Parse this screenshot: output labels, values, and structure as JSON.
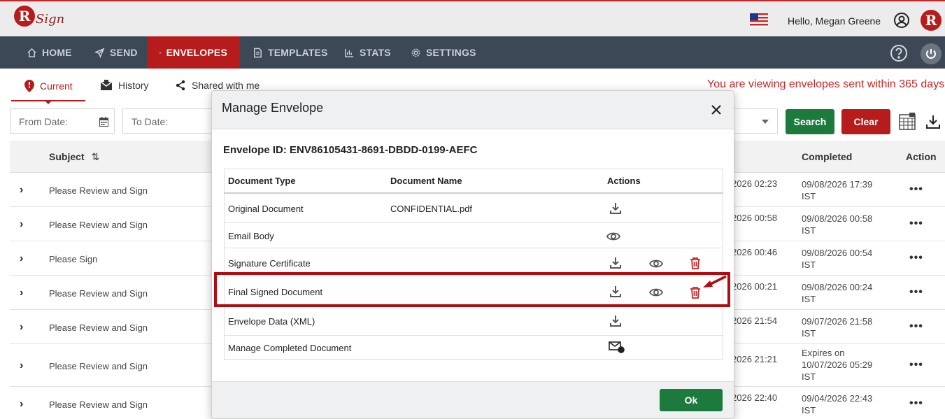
{
  "header": {
    "brand_text": "Sign",
    "greeting": "Hello, Megan Greene",
    "brand_initial": "R"
  },
  "nav": {
    "items": [
      {
        "label": "HOME",
        "icon": "home-icon"
      },
      {
        "label": "SEND",
        "icon": "send-icon"
      },
      {
        "label": "ENVELOPES",
        "icon": "envelope-icon",
        "active": true
      },
      {
        "label": "TEMPLATES",
        "icon": "document-icon"
      },
      {
        "label": "STATS",
        "icon": "chart-icon"
      },
      {
        "label": "SETTINGS",
        "icon": "gear-icon"
      }
    ]
  },
  "subtabs": {
    "current": "Current",
    "history": "History",
    "shared": "Shared with me"
  },
  "notice": "You are viewing envelopes sent within 365 days.",
  "filters": {
    "from_date": "From Date:",
    "to_date": "To Date:",
    "search": "Search",
    "clear": "Clear"
  },
  "table": {
    "headers": {
      "subject": "Subject",
      "completed": "Completed",
      "action": "Action"
    },
    "rows": [
      {
        "subject": "Please Review and Sign",
        "sent": "2026 02:23",
        "completed": "09/08/2026 17:39 IST"
      },
      {
        "subject": "Please Review and Sign",
        "sent": "2026 00:58",
        "completed": "09/08/2026 00:58 IST"
      },
      {
        "subject": "Please Sign",
        "sent": "2026 00:46",
        "completed": "09/08/2026 00:54 IST"
      },
      {
        "subject": "Please Review and Sign",
        "sent": "2026 00:21",
        "completed": "09/08/2026 00:24 IST"
      },
      {
        "subject": "Please Review and Sign",
        "sent": "2026 21:54",
        "completed": "09/07/2026 21:58 IST"
      },
      {
        "subject": "Please Review and Sign",
        "sent": "2026 21:21",
        "completed": "Expires on 10/07/2026 05:29 IST"
      },
      {
        "subject": "Please Review and Sign",
        "sent": "2026 22:40",
        "completed": "09/04/2026 22:43 IST"
      }
    ]
  },
  "modal": {
    "title": "Manage Envelope",
    "envelope_id": "Envelope ID: ENV86105431-8691-DBDD-0199-AEFC",
    "headers": {
      "type": "Document Type",
      "name": "Document Name",
      "actions": "Actions"
    },
    "rows": [
      {
        "type": "Original Document",
        "name": "CONFIDENTIAL.pdf"
      },
      {
        "type": "Email Body",
        "name": ""
      },
      {
        "type": "Signature Certificate",
        "name": ""
      },
      {
        "type": "Final Signed Document",
        "name": ""
      },
      {
        "type": "Envelope Data (XML)",
        "name": ""
      },
      {
        "type": "Manage Completed Document",
        "name": ""
      }
    ],
    "ok": "Ok"
  },
  "colors": {
    "brand_red": "#b71c1c",
    "nav_bg": "#3c4856",
    "ok_green": "#1b7a3c",
    "highlight": "#b00d12"
  }
}
